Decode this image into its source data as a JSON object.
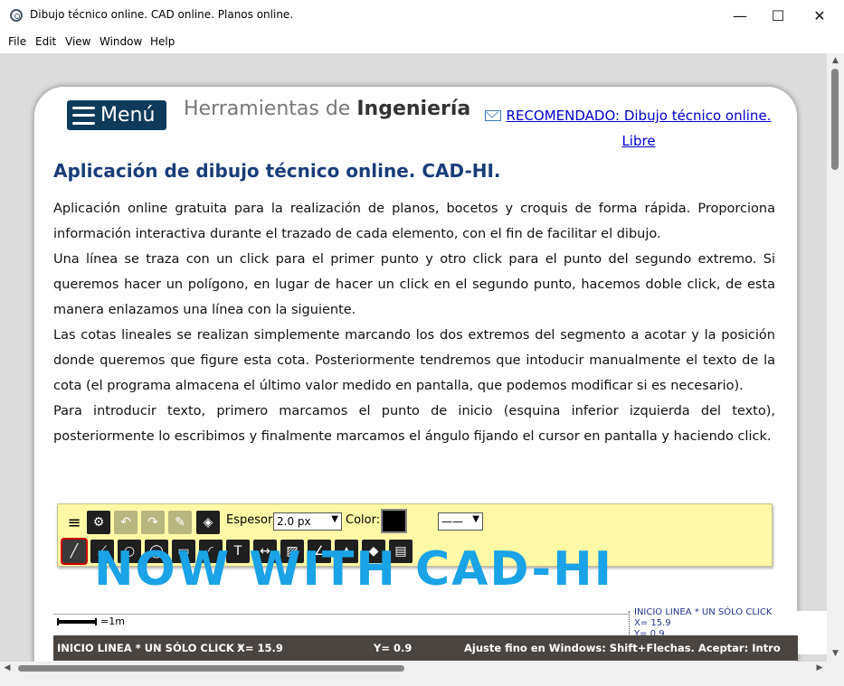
{
  "window": {
    "title": "Dibujo técnico online. CAD online. Planos online.",
    "controls": {
      "minimize": "—",
      "maximize": "☐",
      "close": "✕"
    }
  },
  "menubar": {
    "items": [
      "File",
      "Edit",
      "View",
      "Window",
      "Help"
    ]
  },
  "header": {
    "menu_label": "Menú",
    "brand_light": "Herramientas de ",
    "brand_bold": "Ingeniería",
    "recommended_link": "RECOMENDADO: Dibujo técnico online. Libre"
  },
  "article": {
    "title": "Aplicación de dibujo técnico online. CAD-HI.",
    "paragraphs": [
      "Aplicación online gratuita para la realización de planos, bocetos y croquis de forma rápida. Proporciona información interactiva durante el trazado de cada elemento, con el fin de facilitar el dibujo.",
      "Una línea se traza con un click para el primer punto y otro click para el punto del segundo extremo. Si queremos hacer un polígono, en lugar de hacer un click en el segundo punto, hacemos doble click, de esta manera enlazamos una línea con la siguiente.",
      "Las cotas lineales se realizan simplemente marcando los dos extremos del segmento a acotar y la posición donde queremos que figure esta cota. Posteriormente tendremos que intoducir manualmente el texto de la cota (el programa almacena el último valor medido en pantalla, que podemos modificar si es necesario).",
      "Para introducir texto, primero marcamos el punto de inicio (esquina inferior izquierda del texto), posteriormente lo escribimos y finalmente marcamos el ángulo fijando el cursor en pantalla y haciendo click."
    ]
  },
  "toolbar": {
    "espesor_label": "Espesor:",
    "espesor_value": "2.0 px",
    "color_label": "Color:",
    "color_value": "#000000",
    "linestyle_value": "——",
    "icons_row1": [
      "menu-icon",
      "gear-icon",
      "undo-icon",
      "redo-icon",
      "pencil-icon",
      "layers-icon"
    ],
    "icons_row2": [
      "line-tool-icon",
      "polyline-icon",
      "circle-icon",
      "ellipse-icon",
      "rectangle-icon",
      "arc-icon",
      "text-icon",
      "dimension-icon",
      "hatch-icon",
      "angle-icon",
      "fill-icon",
      "eraser-icon",
      "image-icon"
    ]
  },
  "overlay": {
    "text": "NOW WITH CAD-HI"
  },
  "canvas": {
    "scale_label": "=1m",
    "side_info": {
      "line1": "INICIO LINEA * UN SÓLO CLICK",
      "line2": "X= 15.9",
      "line3": "Y= 0.9"
    }
  },
  "status": {
    "mode": "INICIO LINEA * UN SÓLO CLICK *",
    "x": "X= 15.9",
    "y": "Y= 0.9",
    "hint": "Ajuste fino en Windows: Shift+Flechas. Aceptar: Intro"
  },
  "colors": {
    "accent_blue": "#1aa3e6",
    "menu_bg": "#0e3b5c",
    "title_blue": "#1a3d7a",
    "toolbar_bg": "#fdf9a6",
    "status_bg": "#4a4540"
  }
}
